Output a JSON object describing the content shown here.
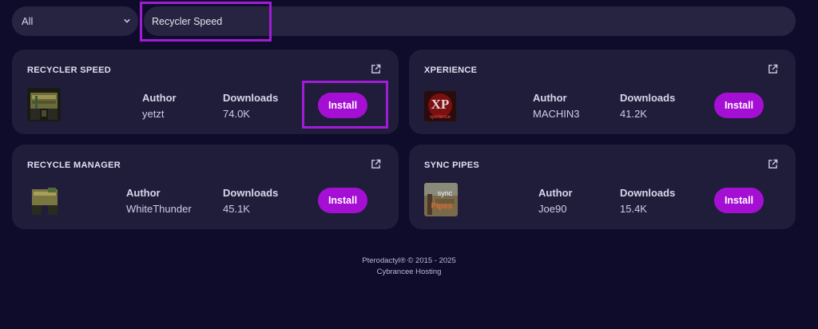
{
  "filter": {
    "selected": "All"
  },
  "search": {
    "value": "Recycler Speed"
  },
  "labels": {
    "author": "Author",
    "downloads": "Downloads",
    "install": "Install"
  },
  "plugins": [
    {
      "title": "RECYCLER SPEED",
      "author": "yetzt",
      "downloads": "74.0K"
    },
    {
      "title": "XPERIENCE",
      "author": "MACHIN3",
      "downloads": "41.2K",
      "thumb_text": "XP xperience"
    },
    {
      "title": "RECYCLE MANAGER",
      "author": "WhiteThunder",
      "downloads": "45.1K"
    },
    {
      "title": "SYNC PIPES",
      "author": "Joe90",
      "downloads": "15.4K",
      "thumb_text": "sync Pipes"
    }
  ],
  "footer": {
    "line1": "Pterodactyl® © 2015 - 2025",
    "line2": "Cybrancee Hosting"
  },
  "colors": {
    "background": "#0f0c2b",
    "card": "#1f1d3a",
    "accent": "#a50fd4",
    "highlight": "#a11cd6"
  },
  "icons": {
    "dropdown": "chevron-down-icon",
    "external": "external-link-icon"
  }
}
